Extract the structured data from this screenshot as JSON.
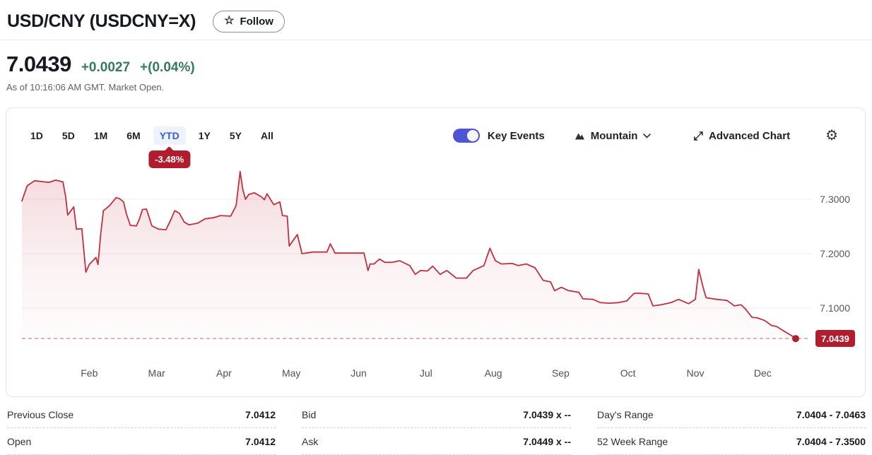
{
  "header": {
    "title": "USD/CNY (USDCNY=X)",
    "follow_label": "Follow"
  },
  "price": {
    "value": "7.0439",
    "change": "+0.0027",
    "change_percent": "+(0.04%)",
    "as_of": "As of 10:16:06 AM GMT. Market Open."
  },
  "chart_card": {
    "ranges": [
      {
        "label": "1D"
      },
      {
        "label": "5D"
      },
      {
        "label": "1M"
      },
      {
        "label": "6M"
      },
      {
        "label": "YTD"
      },
      {
        "label": "1Y"
      },
      {
        "label": "5Y"
      },
      {
        "label": "All"
      }
    ],
    "active_range": "YTD",
    "ytd_change": "-3.48%",
    "key_events_label": "Key Events",
    "key_events_on": true,
    "chart_type": "Mountain",
    "advanced_chart_label": "Advanced Chart"
  },
  "chart_data": {
    "type": "area",
    "title": "USD/CNY year-to-date price (mountain chart)",
    "x_unit": "months since Jan 1",
    "x_tick_labels": [
      "Feb",
      "Mar",
      "Apr",
      "May",
      "Jun",
      "Jul",
      "Aug",
      "Sep",
      "Oct",
      "Nov",
      "Dec"
    ],
    "x_tick_positions": [
      1,
      2,
      3,
      4,
      5,
      6,
      7,
      8,
      9,
      10,
      11
    ],
    "y_ticks": [
      7.3,
      7.2,
      7.1
    ],
    "y_tick_labels": [
      "7.3000",
      "7.2000",
      "7.1000"
    ],
    "ylim": [
      7.01,
      7.36
    ],
    "grid": "horizontal",
    "legend": "none",
    "current_value": 7.0439,
    "current_value_label": "7.0439",
    "points": [
      [
        0,
        7.297
      ],
      [
        0.08,
        7.325
      ],
      [
        0.19,
        7.334
      ],
      [
        0.4,
        7.331
      ],
      [
        0.5,
        7.335
      ],
      [
        0.61,
        7.332
      ],
      [
        0.65,
        7.305
      ],
      [
        0.68,
        7.271
      ],
      [
        0.77,
        7.286
      ],
      [
        0.81,
        7.245
      ],
      [
        0.89,
        7.246
      ],
      [
        0.95,
        7.166
      ],
      [
        1,
        7.18
      ],
      [
        1.1,
        7.193
      ],
      [
        1.13,
        7.18
      ],
      [
        1.17,
        7.236
      ],
      [
        1.21,
        7.279
      ],
      [
        1.3,
        7.288
      ],
      [
        1.4,
        7.303
      ],
      [
        1.45,
        7.301
      ],
      [
        1.51,
        7.295
      ],
      [
        1.55,
        7.274
      ],
      [
        1.61,
        7.252
      ],
      [
        1.7,
        7.251
      ],
      [
        1.74,
        7.262
      ],
      [
        1.79,
        7.281
      ],
      [
        1.85,
        7.282
      ],
      [
        1.93,
        7.251
      ],
      [
        2.03,
        7.245
      ],
      [
        2.14,
        7.244
      ],
      [
        2.21,
        7.262
      ],
      [
        2.27,
        7.279
      ],
      [
        2.34,
        7.274
      ],
      [
        2.41,
        7.258
      ],
      [
        2.48,
        7.253
      ],
      [
        2.61,
        7.256
      ],
      [
        2.72,
        7.264
      ],
      [
        2.84,
        7.266
      ],
      [
        2.95,
        7.27
      ],
      [
        3.1,
        7.269
      ],
      [
        3.18,
        7.288
      ],
      [
        3.24,
        7.351
      ],
      [
        3.28,
        7.318
      ],
      [
        3.32,
        7.3
      ],
      [
        3.37,
        7.309
      ],
      [
        3.45,
        7.312
      ],
      [
        3.56,
        7.304
      ],
      [
        3.6,
        7.299
      ],
      [
        3.64,
        7.31
      ],
      [
        3.74,
        7.29
      ],
      [
        3.83,
        7.295
      ],
      [
        3.87,
        7.27
      ],
      [
        3.94,
        7.269
      ],
      [
        3.97,
        7.214
      ],
      [
        4.02,
        7.223
      ],
      [
        4.09,
        7.235
      ],
      [
        4.16,
        7.2
      ],
      [
        4.32,
        7.203
      ],
      [
        4.53,
        7.203
      ],
      [
        4.58,
        7.218
      ],
      [
        4.65,
        7.201
      ],
      [
        4.94,
        7.201
      ],
      [
        5.08,
        7.201
      ],
      [
        5.14,
        7.169
      ],
      [
        5.17,
        7.181
      ],
      [
        5.23,
        7.181
      ],
      [
        5.31,
        7.19
      ],
      [
        5.39,
        7.184
      ],
      [
        5.5,
        7.184
      ],
      [
        5.61,
        7.187
      ],
      [
        5.76,
        7.178
      ],
      [
        5.84,
        7.162
      ],
      [
        5.92,
        7.169
      ],
      [
        6.02,
        7.168
      ],
      [
        6.1,
        7.177
      ],
      [
        6.21,
        7.162
      ],
      [
        6.31,
        7.169
      ],
      [
        6.45,
        7.155
      ],
      [
        6.6,
        7.155
      ],
      [
        6.7,
        7.169
      ],
      [
        6.86,
        7.178
      ],
      [
        6.95,
        7.21
      ],
      [
        7.03,
        7.187
      ],
      [
        7.12,
        7.181
      ],
      [
        7.28,
        7.182
      ],
      [
        7.37,
        7.178
      ],
      [
        7.49,
        7.181
      ],
      [
        7.62,
        7.174
      ],
      [
        7.74,
        7.151
      ],
      [
        7.85,
        7.148
      ],
      [
        7.91,
        7.132
      ],
      [
        8.01,
        7.138
      ],
      [
        8.12,
        7.132
      ],
      [
        8.27,
        7.129
      ],
      [
        8.33,
        7.117
      ],
      [
        8.48,
        7.116
      ],
      [
        8.59,
        7.11
      ],
      [
        8.72,
        7.109
      ],
      [
        8.86,
        7.11
      ],
      [
        8.98,
        7.113
      ],
      [
        9.09,
        7.127
      ],
      [
        9.19,
        7.127
      ],
      [
        9.3,
        7.126
      ],
      [
        9.37,
        7.104
      ],
      [
        9.49,
        7.106
      ],
      [
        9.64,
        7.11
      ],
      [
        9.75,
        7.116
      ],
      [
        9.9,
        7.108
      ],
      [
        10,
        7.116
      ],
      [
        10.05,
        7.171
      ],
      [
        10.12,
        7.136
      ],
      [
        10.16,
        7.119
      ],
      [
        10.32,
        7.116
      ],
      [
        10.47,
        7.114
      ],
      [
        10.58,
        7.104
      ],
      [
        10.68,
        7.106
      ],
      [
        10.74,
        7.099
      ],
      [
        10.84,
        7.083
      ],
      [
        10.92,
        7.082
      ],
      [
        11.03,
        7.077
      ],
      [
        11.13,
        7.068
      ],
      [
        11.21,
        7.066
      ],
      [
        11.31,
        7.058
      ],
      [
        11.42,
        7.05
      ],
      [
        11.49,
        7.0439
      ]
    ]
  },
  "stats": {
    "items": [
      {
        "label": "Previous Close",
        "value": "7.0412"
      },
      {
        "label": "Bid",
        "value": "7.0439 x --"
      },
      {
        "label": "Day's Range",
        "value": "7.0404 - 7.0463"
      },
      {
        "label": "Open",
        "value": "7.0412"
      },
      {
        "label": "Ask",
        "value": "7.0449 x --"
      },
      {
        "label": "52 Week Range",
        "value": "7.0404 - 7.3500"
      }
    ]
  },
  "icons": {
    "star": "☆",
    "gear": "⚙",
    "advanced_arrow": "⤢"
  },
  "colors": {
    "accent_blue": "#3a5bd9",
    "toggle_blue": "#4d55d4",
    "chart_line": "#c22f3e",
    "badge_red": "#b01e2e",
    "change_green": "#357c5d"
  }
}
